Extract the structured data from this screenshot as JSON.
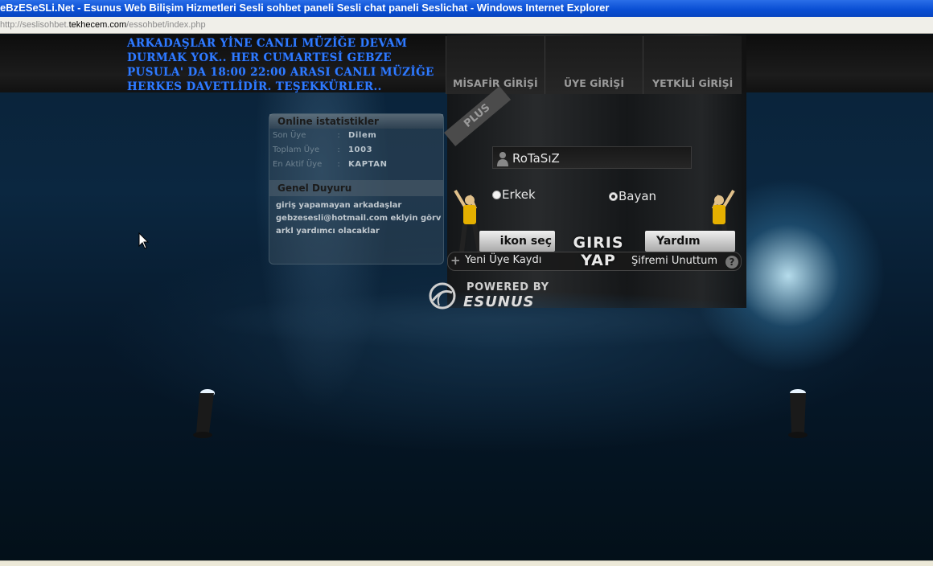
{
  "window": {
    "title": "eBzESeSLi.Net - Esunus Web Bilişim Hizmetleri Sesli sohbet paneli Sesli chat paneli Seslichat  - Windows Internet Explorer"
  },
  "address": {
    "prefix": "http://seslisohbet.",
    "host": "tekhecem.com",
    "path": "/essohbet/index.php"
  },
  "announcement_banner": "ARKADAŞLAR YİNE CANLI MÜZİĞE DEVAM DURMAK YOK.. HER CUMARTESİ GEBZE PUSULA' DA 18:00  22:00 ARASI CANLI MÜZİĞE HERKES DAVETLİDİR. TEŞEKKÜRLER..",
  "tabs": [
    {
      "label": "MİSAFİR GİRİŞİ"
    },
    {
      "label": "ÜYE GİRİŞİ"
    },
    {
      "label": "YETKİLİ GİRİŞİ"
    }
  ],
  "plus_badge": "PLUS",
  "stats": {
    "title": "Online istatistikler",
    "rows": [
      {
        "label": "Son Üye",
        "sep": ":",
        "value": "Dilem"
      },
      {
        "label": "Toplam Üye",
        "sep": ":",
        "value": "1003"
      },
      {
        "label": "En Aktif Üye",
        "sep": ":",
        "value": "KAPTAN"
      }
    ]
  },
  "notice": {
    "title": "Genel Duyuru",
    "lines": [
      "giriş yapamayan arkadaşlar",
      "gebzesesli@hotmail.com eklyin görv",
      "arkl yardımcı olacaklar"
    ]
  },
  "login": {
    "nickname_value": "RoTaSıZ",
    "gender_male": "Erkek",
    "gender_female": "Bayan",
    "selected_gender": "Bayan",
    "icon_button": "ikon seç",
    "help_button": "Yardım",
    "submit_line1": "GIRIS",
    "submit_line2": "YAP",
    "register_link": "Yeni Üye Kaydı",
    "forgot_link": "Şifremi Unuttum",
    "help_mark": "?"
  },
  "powered": {
    "line1": "POWERED BY",
    "line2": "ESUNUS"
  },
  "colors": {
    "banner_text": "#2f7bff",
    "background": "#0b2740",
    "titlebar": "#0a4fd4"
  }
}
